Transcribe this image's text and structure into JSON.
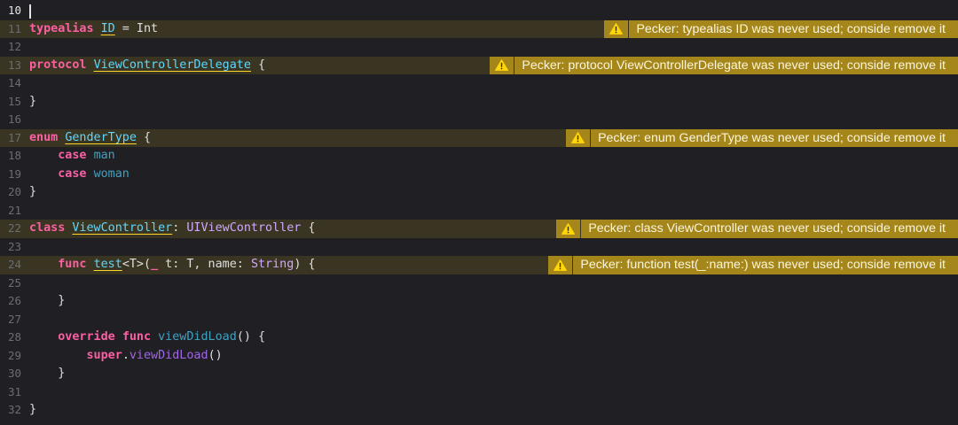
{
  "lines": [
    {
      "num": "10",
      "active": true
    },
    {
      "num": "11",
      "tokens": [
        {
          "t": "typealias",
          "c": "kw"
        },
        {
          "t": " ",
          "c": "plain"
        },
        {
          "t": "ID",
          "c": "decl"
        },
        {
          "t": " = Int",
          "c": "plain"
        }
      ],
      "warning": "Pecker: typealias ID was never used; conside remove it"
    },
    {
      "num": "12"
    },
    {
      "num": "13",
      "tokens": [
        {
          "t": "protocol",
          "c": "kw"
        },
        {
          "t": " ",
          "c": "plain"
        },
        {
          "t": "ViewControllerDelegate",
          "c": "decl"
        },
        {
          "t": " {",
          "c": "plain"
        }
      ],
      "warning": "Pecker: protocol ViewControllerDelegate was never used; conside remove it"
    },
    {
      "num": "14"
    },
    {
      "num": "15",
      "tokens": [
        {
          "t": "}",
          "c": "plain"
        }
      ]
    },
    {
      "num": "16"
    },
    {
      "num": "17",
      "tokens": [
        {
          "t": "enum",
          "c": "kw"
        },
        {
          "t": " ",
          "c": "plain"
        },
        {
          "t": "GenderType",
          "c": "decl"
        },
        {
          "t": " {",
          "c": "plain"
        }
      ],
      "warning": "Pecker: enum GenderType was never used; conside remove it"
    },
    {
      "num": "18",
      "tokens": [
        {
          "t": "    ",
          "c": "plain"
        },
        {
          "t": "case",
          "c": "kw"
        },
        {
          "t": " ",
          "c": "plain"
        },
        {
          "t": "man",
          "c": "ident"
        }
      ]
    },
    {
      "num": "19",
      "tokens": [
        {
          "t": "    ",
          "c": "plain"
        },
        {
          "t": "case",
          "c": "kw"
        },
        {
          "t": " ",
          "c": "plain"
        },
        {
          "t": "woman",
          "c": "ident"
        }
      ]
    },
    {
      "num": "20",
      "tokens": [
        {
          "t": "}",
          "c": "plain"
        }
      ]
    },
    {
      "num": "21"
    },
    {
      "num": "22",
      "tokens": [
        {
          "t": "class",
          "c": "kw"
        },
        {
          "t": " ",
          "c": "plain"
        },
        {
          "t": "ViewController",
          "c": "decl"
        },
        {
          "t": ": ",
          "c": "plain"
        },
        {
          "t": "UIViewController",
          "c": "type"
        },
        {
          "t": " {",
          "c": "plain"
        }
      ],
      "warning": "Pecker: class ViewController was never used; conside remove it"
    },
    {
      "num": "23"
    },
    {
      "num": "24",
      "tokens": [
        {
          "t": "    ",
          "c": "plain"
        },
        {
          "t": "func",
          "c": "kw"
        },
        {
          "t": " ",
          "c": "plain"
        },
        {
          "t": "test",
          "c": "decl"
        },
        {
          "t": "<T>(",
          "c": "plain"
        },
        {
          "t": "_",
          "c": "kw"
        },
        {
          "t": " t: T, name: ",
          "c": "plain"
        },
        {
          "t": "String",
          "c": "type"
        },
        {
          "t": ") {",
          "c": "plain"
        }
      ],
      "warning": "Pecker: function test(_:name:) was never used; conside remove it"
    },
    {
      "num": "25"
    },
    {
      "num": "26",
      "tokens": [
        {
          "t": "    }",
          "c": "plain"
        }
      ]
    },
    {
      "num": "27"
    },
    {
      "num": "28",
      "tokens": [
        {
          "t": "    ",
          "c": "plain"
        },
        {
          "t": "override",
          "c": "kw"
        },
        {
          "t": " ",
          "c": "plain"
        },
        {
          "t": "func",
          "c": "kw"
        },
        {
          "t": " ",
          "c": "plain"
        },
        {
          "t": "viewDidLoad",
          "c": "fn-decl"
        },
        {
          "t": "() {",
          "c": "plain"
        }
      ]
    },
    {
      "num": "29",
      "tokens": [
        {
          "t": "        ",
          "c": "plain"
        },
        {
          "t": "super",
          "c": "kw"
        },
        {
          "t": ".",
          "c": "plain"
        },
        {
          "t": "viewDidLoad",
          "c": "fn-call"
        },
        {
          "t": "()",
          "c": "plain"
        }
      ]
    },
    {
      "num": "30",
      "tokens": [
        {
          "t": "    }",
          "c": "plain"
        }
      ]
    },
    {
      "num": "31"
    },
    {
      "num": "32",
      "tokens": [
        {
          "t": "}",
          "c": "plain"
        }
      ]
    }
  ],
  "warning_icon": "warning-triangle-icon",
  "colors": {
    "background": "#1f1f24",
    "warning_line_bg": "#3a3422",
    "warning_badge": "#a5861a",
    "keyword": "#fc5fa3",
    "declaration": "#5dd8ff"
  }
}
